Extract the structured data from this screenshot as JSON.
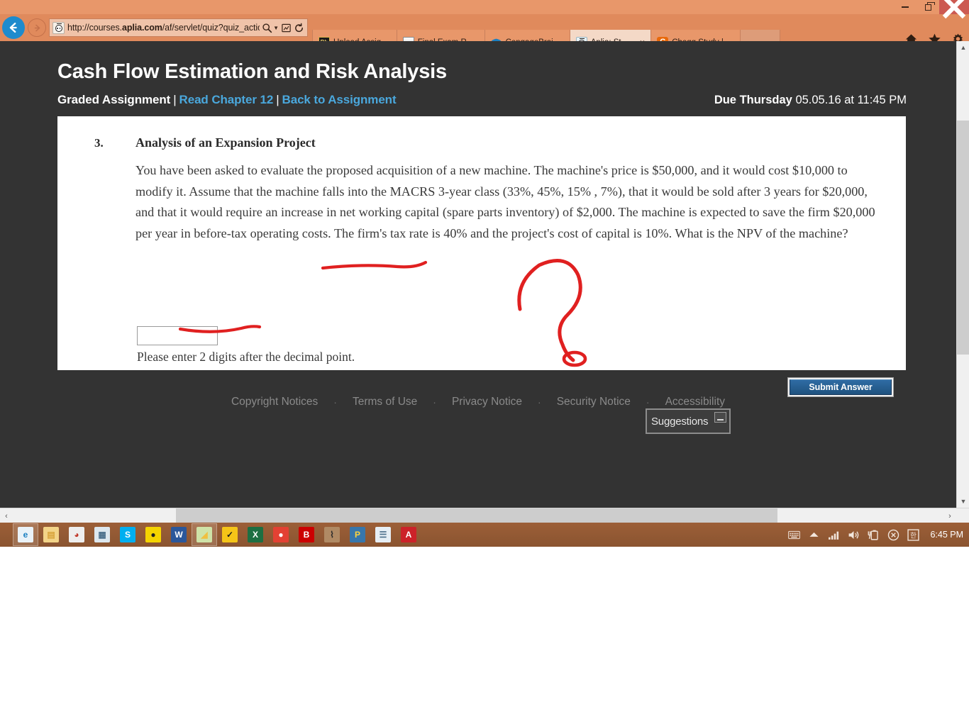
{
  "browser": {
    "window_controls": {
      "minimize": "minimize-button",
      "maximize": "maximize-button",
      "close": "close-button"
    },
    "url": "http://courses.aplia.com/af/servlet/quiz?quiz_actio",
    "url_parts": {
      "prefix": "http://courses.",
      "domain": "aplia.com",
      "suffix": "/af/servlet/quiz?quiz_actio"
    },
    "tabs": [
      {
        "label": "Upload Assignment: As...",
        "favicon": "blackboard-icon",
        "active": false,
        "closable": false
      },
      {
        "label": "Final Exam Review",
        "favicon": "document-icon",
        "active": false,
        "closable": false
      },
      {
        "label": "CengageBrain - My Ho...",
        "favicon": "internet-explorer-icon",
        "active": false,
        "closable": false
      },
      {
        "label": "Aplia: Student Quest...",
        "favicon": "aplia-icon",
        "active": true,
        "closable": true
      },
      {
        "label": "Chegg Study | Guided S...",
        "favicon": "chegg-icon",
        "active": false,
        "closable": false
      }
    ],
    "tab_close_glyph": "×",
    "tools": [
      "home-icon",
      "favorites-star-icon",
      "settings-gear-icon"
    ]
  },
  "page": {
    "title": "Cash Flow Estimation and Risk Analysis",
    "subnav": {
      "status": "Graded Assignment",
      "links": [
        "Read Chapter 12",
        "Back to Assignment"
      ],
      "separator": "|"
    },
    "due": {
      "prefix": "Due Thursday",
      "value": "05.05.16 at 11:45 PM"
    },
    "question": {
      "number": "3.",
      "heading": "Analysis of an Expansion Project",
      "body": "You have been asked to evaluate the proposed acquisition of a new machine. The machine's price is $50,000, and it would cost $10,000 to modify it. Assume that the machine falls into the MACRS 3-year class (33%, 45%, 15% , 7%), that it would be sold after 3 years for $20,000, and that it would require an increase in net working capital (spare parts inventory) of $2,000. The machine is expected to save the firm $20,000 per year in before-tax operating costs. The firm's tax rate is 40% and the project's cost of capital is 10%. What is the NPV of the machine?",
      "answer_value": "",
      "answer_placeholder": "",
      "hint": "Please enter 2 digits after the decimal point.",
      "submit_label": "Submit Answer"
    },
    "footer_links": [
      "Copyright Notices",
      "Terms of Use",
      "Privacy Notice",
      "Security Notice",
      "Accessibility"
    ],
    "footer_separator": "·",
    "suggestions_widget": {
      "label": "Suggestions",
      "minimize": "minimize-button"
    }
  },
  "annotations": {
    "description": "hand-drawn red ink marks",
    "color": "#e02020",
    "marks": [
      "underline-under-npv-question",
      "large-question-mark",
      "underline-under-hint"
    ]
  },
  "taskbar": {
    "items": [
      {
        "name": "internet-explorer",
        "glyph": "e",
        "color": "#1a7fc1",
        "bg": "#eaf2f8",
        "active": true
      },
      {
        "name": "file-explorer",
        "glyph": "▤",
        "color": "#d8a33a",
        "bg": "#f3d488",
        "active": false
      },
      {
        "name": "paint",
        "glyph": "◕",
        "color": "#c0392b",
        "bg": "#eeeeee",
        "active": false
      },
      {
        "name": "calculator",
        "glyph": "▦",
        "color": "#4a6e8a",
        "bg": "#dde7ee",
        "active": false
      },
      {
        "name": "skype",
        "glyph": "S",
        "color": "#ffffff",
        "bg": "#00aff0",
        "active": false
      },
      {
        "name": "sticky-notes",
        "glyph": "●",
        "color": "#222222",
        "bg": "#f5d400",
        "active": false
      },
      {
        "name": "microsoft-word",
        "glyph": "W",
        "color": "#ffffff",
        "bg": "#2b579a",
        "active": false
      },
      {
        "name": "snipping-tool",
        "glyph": "◢",
        "color": "#f0c040",
        "bg": "#cfe3a8",
        "active": true
      },
      {
        "name": "norton-security",
        "glyph": "✓",
        "color": "#1c1c1c",
        "bg": "#f5c518",
        "active": false
      },
      {
        "name": "microsoft-excel",
        "glyph": "X",
        "color": "#ffffff",
        "bg": "#1d6f42",
        "active": false
      },
      {
        "name": "google-chrome",
        "glyph": "●",
        "color": "#ffffff",
        "bg": "#e34133",
        "active": false
      },
      {
        "name": "bitdefender",
        "glyph": "B",
        "color": "#ffffff",
        "bg": "#cc0000",
        "active": false
      },
      {
        "name": "microphone",
        "glyph": "⌇",
        "color": "#2b2b2b",
        "bg": "#b08a64",
        "active": false
      },
      {
        "name": "python",
        "glyph": "P",
        "color": "#ffd43b",
        "bg": "#3776ab",
        "active": false
      },
      {
        "name": "notepad",
        "glyph": "☰",
        "color": "#4a6e8a",
        "bg": "#e6eef5",
        "active": false
      },
      {
        "name": "adobe-acrobat",
        "glyph": "A",
        "color": "#ffffff",
        "bg": "#cc2229",
        "active": false
      }
    ],
    "tray": [
      "keyboard-icon",
      "show-hidden-icons-arrow",
      "network-signal-icon",
      "volume-icon",
      "battery-icon",
      "action-center-icon",
      "language-icon"
    ],
    "language_glyph": "한",
    "clock": "6:45 PM"
  },
  "scrollbars": {
    "vertical": {
      "up_glyph": "▲",
      "down_glyph": "▼"
    },
    "horizontal": {
      "left_glyph": "‹",
      "right_glyph": "›"
    }
  }
}
